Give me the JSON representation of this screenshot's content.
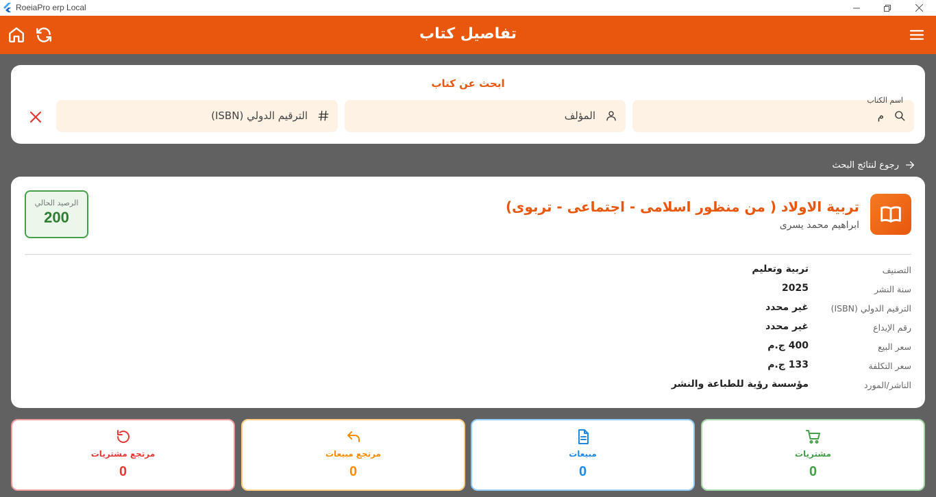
{
  "window": {
    "title": "RoeiaPro erp Local"
  },
  "appbar": {
    "title": "تفاصيل كتاب"
  },
  "search": {
    "title": "ابحث عن كتاب",
    "book_name_label": "اسم الكتاب",
    "book_name_value": "م",
    "author_placeholder": "المؤلف",
    "isbn_placeholder": "الترقيم الدولي (ISBN)"
  },
  "back_link": "رجوع لنتائج البحث",
  "book": {
    "title": "تربية الاولاد ( من منظور اسلامى - اجتماعى - تربوى)",
    "author": "ابراهيم محمد يسرى",
    "balance_label": "الرصيد الحالي",
    "balance_value": "200",
    "info": [
      {
        "label": "التصنيف",
        "value": "تربية وتعليم"
      },
      {
        "label": "سنة النشر",
        "value": "2025"
      },
      {
        "label": "الترقيم الدولي (ISBN)",
        "value": "غير محدد"
      },
      {
        "label": "رقم الإيداع",
        "value": "غير محدد"
      },
      {
        "label": "سعر البيع",
        "value": "400 ج.م"
      },
      {
        "label": "سعر التكلفة",
        "value": "133 ج.م"
      },
      {
        "label": "الناشر/المورد",
        "value": "مؤسسة رؤية للطباعة والنشر"
      }
    ]
  },
  "stats": [
    {
      "label": "مشتريات",
      "value": "0",
      "icon": "cart-icon",
      "color": "#43a047",
      "border": "#a5d6a7"
    },
    {
      "label": "مبيعات",
      "value": "0",
      "icon": "document-icon",
      "color": "#1e88e5",
      "border": "#90caf9"
    },
    {
      "label": "مرتجع مبيعات",
      "value": "0",
      "icon": "undo-icon",
      "color": "#fb8c00",
      "border": "#ffcc80"
    },
    {
      "label": "مرتجع مشتريات",
      "value": "0",
      "icon": "refresh-icon",
      "color": "#e53935",
      "border": "#ef9a9a"
    }
  ],
  "colors": {
    "accent": "#e8570d",
    "background": "#616161",
    "field_background": "#fdf2e4",
    "balance_green": "#2e7d32"
  }
}
